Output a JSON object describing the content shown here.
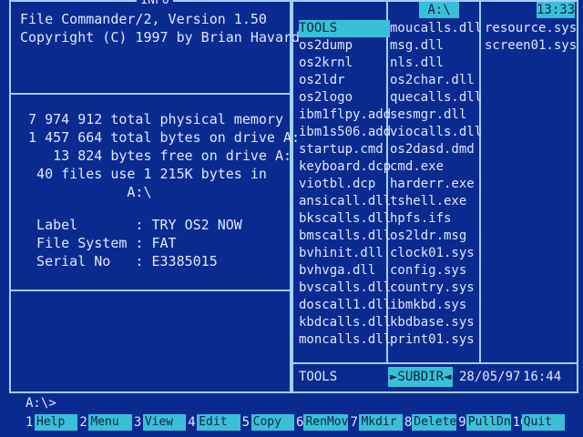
{
  "app": {
    "title_box": "INFO",
    "heading_line1": "File Commander/2, Version 1.50",
    "heading_line2": "Copyright (C) 1997 by Brian Havard"
  },
  "info": {
    "memory_line": " 7 974 912 total physical memory",
    "bytes_total_line": " 1 457 664 total bytes on drive A:",
    "bytes_free_line": "    13 824 bytes free on drive A:",
    "files_line": "  40 files use 1 215K bytes in",
    "path_line": "             A:\\",
    "label_line": "  Label       : TRY OS2 NOW",
    "fs_line": "  File System : FAT",
    "serial_line": "  Serial No   : E3385015"
  },
  "right": {
    "path": "A:\\",
    "clock": "13:33",
    "columns": [
      [
        "TOOLS",
        "os2dump",
        "os2krnl",
        "os2ldr",
        "os2logo",
        "ibm1flpy.add",
        "ibm1s506.add",
        "startup.cmd",
        "keyboard.dcp",
        "viotbl.dcp",
        "ansicall.dll",
        "bkscalls.dll",
        "bmscalls.dll",
        "bvhinit.dll",
        "bvhvga.dll",
        "bvscalls.dll",
        "doscall1.dll",
        "kbdcalls.dll",
        "moncalls.dll"
      ],
      [
        "moucalls.dll",
        "msg.dll",
        "nls.dll",
        "os2char.dll",
        "quecalls.dll",
        "sesmgr.dll",
        "viocalls.dll",
        "os2dasd.dmd",
        "cmd.exe",
        "harderr.exe",
        "tshell.exe",
        "hpfs.ifs",
        "os2ldr.msg",
        "clock01.sys",
        "config.sys",
        "country.sys",
        "ibmkbd.sys",
        "kbdbase.sys",
        "print01.sys"
      ],
      [
        "resource.sys",
        "screen01.sys"
      ]
    ],
    "status": {
      "name": "TOOLS",
      "type": "►SUBDIR◄",
      "date": "28/05/97",
      "time": "16:44"
    }
  },
  "command_line": "A:\\>",
  "function_keys": [
    {
      "num": "1",
      "label": "Help"
    },
    {
      "num": "2",
      "label": "Menu"
    },
    {
      "num": "3",
      "label": "View"
    },
    {
      "num": "4",
      "label": "Edit"
    },
    {
      "num": "5",
      "label": "Copy"
    },
    {
      "num": "6",
      "label": "RenMov"
    },
    {
      "num": "7",
      "label": "Mkdir"
    },
    {
      "num": "8",
      "label": "Delete"
    },
    {
      "num": "9",
      "label": "PullDn"
    },
    {
      "num": "10",
      "label": "Quit"
    }
  ]
}
